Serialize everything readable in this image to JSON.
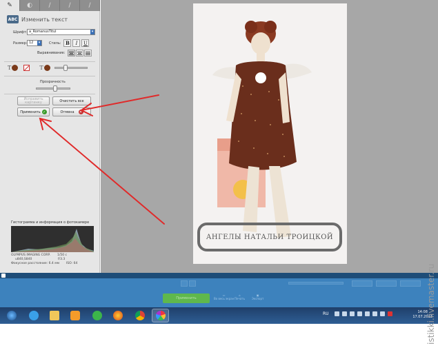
{
  "panel": {
    "tool_tabs": [
      "wrench",
      "circle",
      "brush",
      "pencil",
      "brush2"
    ],
    "title": "Изменить текст",
    "title_icon_text": "ABC",
    "font_label": "Шрифт:",
    "font_value": "a_RomanusTitul",
    "size_label": "Размер:",
    "size_value": "12",
    "style_label": "Стиль:",
    "style_bold": "B",
    "style_italic": "I",
    "style_underline": "U",
    "align_label": "Выравнивание:",
    "transparency_label": "Прозрачность",
    "btn_unmodify": "Исправить\nкартинку",
    "btn_clear": "Очистить все",
    "btn_apply": "Применить",
    "btn_cancel": "Отмена",
    "text_icon": "T",
    "histogram_title": "Гистограмма и информация о фотокамере",
    "camera_model": "OLYMPUS IMAGING CORP.",
    "camera_model2": "u840,S840",
    "shutter": "1/50 с",
    "aperture": "f/3.3",
    "focal_label": "Фокусное расстояние: 6.4 мм",
    "iso": "ISO: 64"
  },
  "photo": {
    "caption": "АНГЕЛЫ НАТАЛЬИ ТРОИЦКОЙ"
  },
  "app_bottom": {
    "apply_label": "Применить",
    "action1": "Во весь экран",
    "action2": "Печать",
    "action3": "Экспорт"
  },
  "taskbar": {
    "language": "RU",
    "time": "14:08",
    "date": "17.07.2013"
  },
  "watermark": "istikki.livemaster.ru",
  "colors": {
    "arrow": "#e02a2a",
    "panel_bg": "#e6e6e6",
    "canvas_bg": "#a7a7a7",
    "taskbar": "#1f3f6a"
  }
}
